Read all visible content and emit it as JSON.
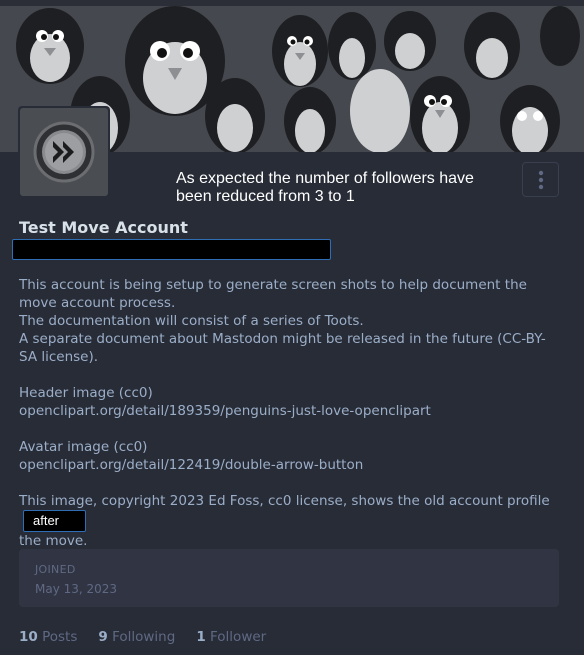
{
  "annotation": {
    "text": "As expected the number of followers have been reduced from 3 to 1"
  },
  "account": {
    "display_name": "Test Move Account"
  },
  "bio": {
    "p1": "This account is being setup to generate screen shots to help document the move account process.",
    "p1b": "The documentation will consist of a series of Toots.",
    "p1c": "A separate document about Mastodon might be released in the future (CC-BY-SA license).",
    "header_label": "Header image (cc0)",
    "header_link": "openclipart.org/detail/189359/penguins-just-love-openclipart",
    "avatar_label": "Avatar image (cc0)",
    "avatar_link": "openclipart.org/detail/122419/double-arrow-button",
    "copyright_before": "This image, copyright 2023 Ed Foss, cc0 license, shows the old account profile",
    "badge": "after",
    "copyright_after": "the move."
  },
  "joined": {
    "label": "JOINED",
    "date": "May 13, 2023"
  },
  "counters": {
    "posts_count": "10",
    "posts_label": "Posts",
    "following_count": "9",
    "following_label": "Following",
    "followers_count": "1",
    "followers_label": "Follower"
  },
  "colors": {
    "background": "#282c37",
    "primary_text": "#d9e1e8",
    "secondary_text": "#9baec8",
    "muted_text": "#606984"
  },
  "icons": {
    "avatar": "double-arrow-button-icon",
    "menu": "vertical-ellipsis-icon"
  }
}
